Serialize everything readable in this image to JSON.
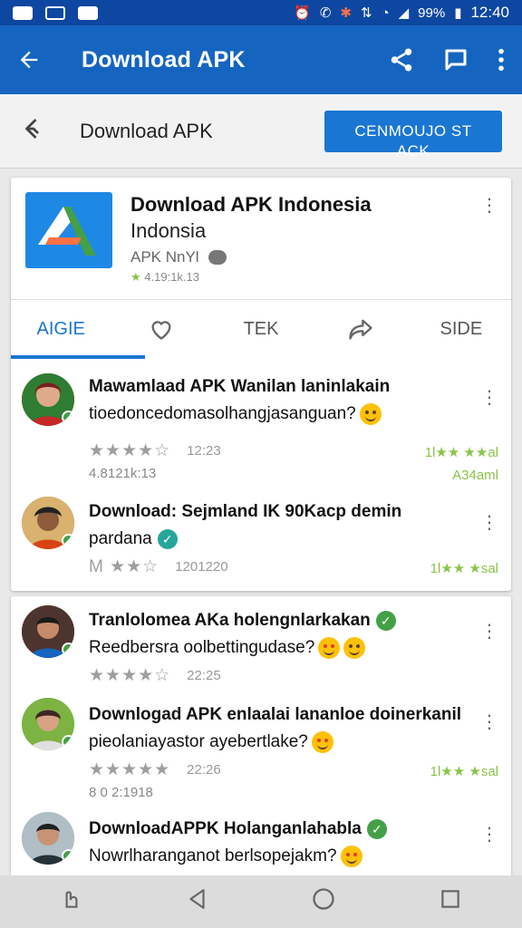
{
  "status_bar": {
    "battery": "99%",
    "time": "12:40"
  },
  "app_bar": {
    "title": "Download APK"
  },
  "sub_header": {
    "title": "Download APK",
    "button_label": "CENMOUJO ST ACK"
  },
  "app_info": {
    "name_line1": "Download APK Indonesia",
    "name_line2": "Indonsia",
    "publisher": "APK NnYl",
    "rating_text": "4.19:1k.13"
  },
  "tabs": [
    {
      "label": "AIGIE"
    },
    {
      "label": ""
    },
    {
      "label": "TEK"
    },
    {
      "label": ""
    },
    {
      "label": "SIDE"
    }
  ],
  "comments": [
    {
      "line1": "Mawamlaad APK Wanilan laninlakain",
      "line2": "tioedoncedomasolhangjasanguan?",
      "time": "12:23",
      "sub": "4.8121k:13",
      "green_top": "1l★★ ★★al",
      "green_bottom": "A34aml"
    },
    {
      "line1": "Download: Sejmland IK 90Kacp demin",
      "line2": "pardana",
      "time": "1201220",
      "prefix": "M",
      "green_top": "1l★★ ★sal"
    },
    {
      "line1": "Tranlolomea AKa holengnlarkakan",
      "line2": "Reedbersra oolbettingudase?",
      "time": "22:25"
    },
    {
      "line1": "Downlogad APK enlaalai lananloe doinerkanil",
      "line2": "pieolaniayastor ayebertlake?",
      "time": "22:26",
      "sub": "8 0 2:1918",
      "green_top": "1l★★ ★sal"
    },
    {
      "line1": "DownloadAPPK Holanganlahabla",
      "line2": "Nowrlharanganot berlsopejakm?"
    }
  ],
  "icons": {
    "back": "arrow-left-icon",
    "share": "share-icon",
    "chat": "chat-icon",
    "overflow": "more-vert-icon",
    "heart": "heart-icon",
    "forward": "forward-icon",
    "nav_back": "triangle-back-icon",
    "nav_home": "circle-home-icon",
    "nav_recent": "square-recent-icon"
  },
  "colors": {
    "primary": "#1565c0",
    "status": "#0d47a1",
    "accent": "#1976d2",
    "green": "#8bc34a"
  }
}
